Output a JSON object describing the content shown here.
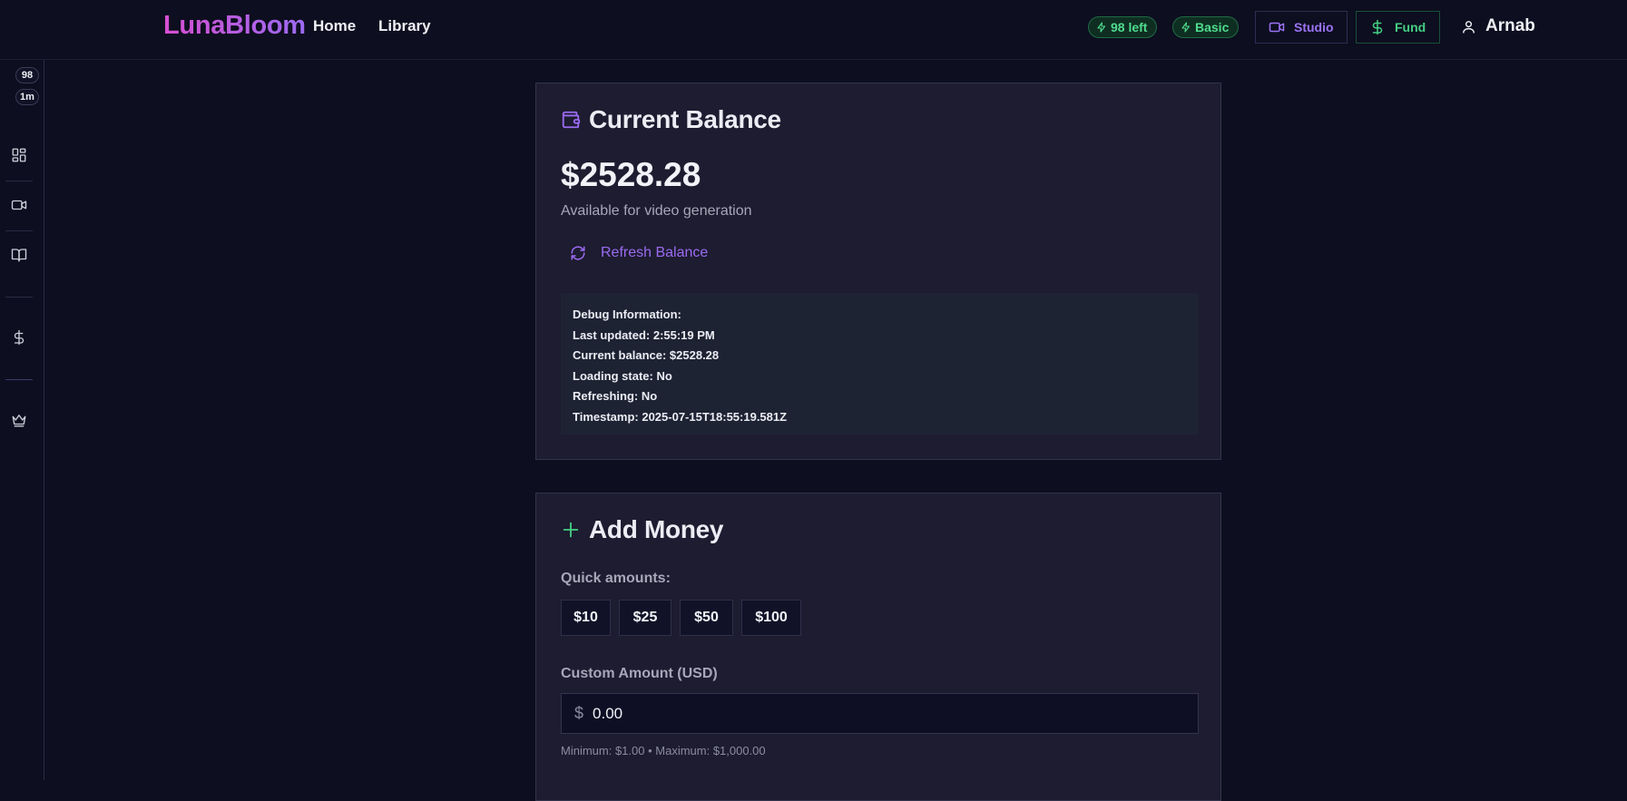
{
  "header": {
    "logo": "LunaBloom",
    "nav": [
      {
        "label": "Home"
      },
      {
        "label": "Library"
      }
    ],
    "credits_pill": "98 left",
    "plan_pill": "Basic",
    "studio_label": "Studio",
    "fund_label": "Fund",
    "user_name": "Arnab"
  },
  "sidebar": {
    "credits_badge": "98",
    "time_badge": "1m",
    "icons": [
      "grid-icon",
      "video-icon",
      "book-icon",
      "dollar-icon",
      "crown-icon"
    ]
  },
  "balance_card": {
    "title": "Current Balance",
    "amount": "$2528.28",
    "subtitle": "Available for video generation",
    "refresh_label": "Refresh Balance",
    "debug": {
      "heading": "Debug Information:",
      "last_updated": "Last updated: 2:55:19 PM",
      "current_balance": "Current balance: $2528.28",
      "loading_state": "Loading state: No",
      "refreshing": "Refreshing: No",
      "timestamp": "Timestamp: 2025-07-15T18:55:19.581Z"
    }
  },
  "add_money_card": {
    "title": "Add Money",
    "quick_label": "Quick amounts:",
    "quick_amounts": [
      "$10",
      "$25",
      "$50",
      "$100"
    ],
    "custom_label": "Custom Amount (USD)",
    "currency_symbol": "$",
    "amount_value": "0.00",
    "limits": "Minimum: $1.00 • Maximum: $1,000.00"
  },
  "colors": {
    "accent_purple": "#9b6bf2",
    "accent_green": "#44cf82",
    "background": "#0d0e1f",
    "card": "#1d1c30"
  }
}
